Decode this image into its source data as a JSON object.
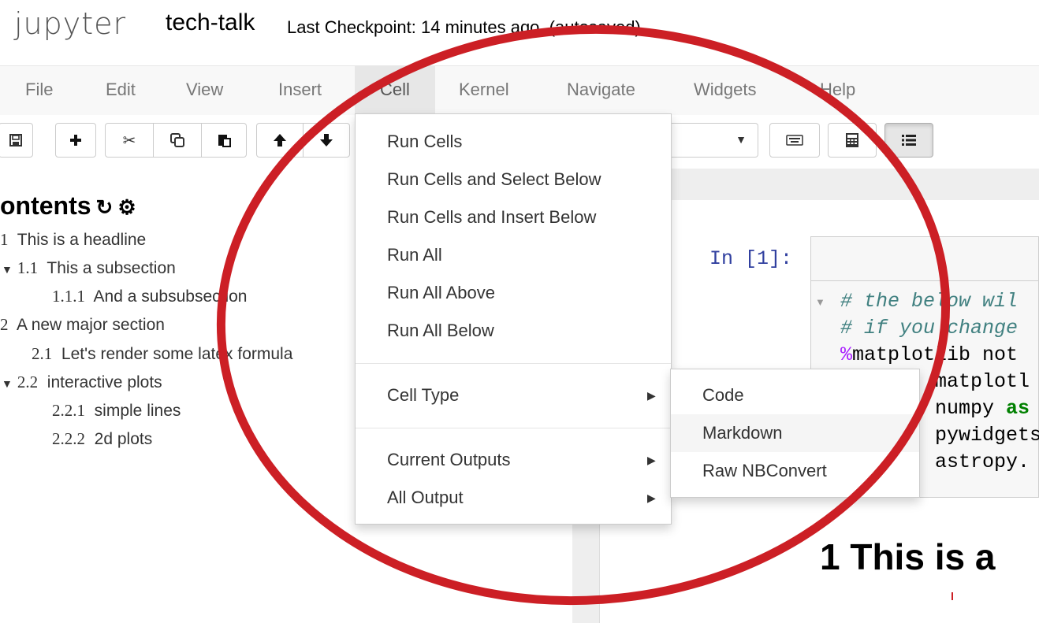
{
  "header": {
    "logo": "jupyter",
    "notebook_name": "tech-talk",
    "checkpoint": "Last Checkpoint: 14 minutes ago",
    "autosave": "(autosaved)"
  },
  "menubar": {
    "items": [
      {
        "label": "File"
      },
      {
        "label": "Edit"
      },
      {
        "label": "View"
      },
      {
        "label": "Insert"
      },
      {
        "label": "Cell"
      },
      {
        "label": "Kernel"
      },
      {
        "label": "Navigate"
      },
      {
        "label": "Widgets"
      },
      {
        "label": "Help"
      }
    ],
    "active": "Cell"
  },
  "toolbar": {
    "icons": [
      "save-icon",
      "plus-icon",
      "scissors-icon",
      "copy-icon",
      "paste-icon",
      "arrow-up-icon",
      "arrow-down-icon",
      "keyboard-icon",
      "calculator-icon",
      "list-icon"
    ],
    "celltype_arrow": "▼"
  },
  "toc": {
    "title": "ontents",
    "refresh_icon": "↻",
    "gear_icon": "⚙",
    "items": [
      {
        "num": "1",
        "label": "This is a headline"
      },
      {
        "num": "1.1",
        "label": "This a subsection"
      },
      {
        "num": "1.1.1",
        "label": "And a subsubsection"
      },
      {
        "num": "2",
        "label": "A new major section"
      },
      {
        "num": "2.1",
        "label": "Let's render some latex formula"
      },
      {
        "num": "2.2",
        "label": "interactive plots"
      },
      {
        "num": "2.2.1",
        "label": "simple lines"
      },
      {
        "num": "2.2.2",
        "label": "2d plots"
      }
    ]
  },
  "cell_menu": {
    "items": [
      {
        "label": "Run Cells"
      },
      {
        "label": "Run Cells and Select Below"
      },
      {
        "label": "Run Cells and Insert Below"
      },
      {
        "label": "Run All"
      },
      {
        "label": "Run All Above"
      },
      {
        "label": "Run All Below"
      },
      {
        "label": "Cell Type"
      },
      {
        "label": "Current Outputs"
      },
      {
        "label": "All Output"
      }
    ],
    "submenu_arrow": "▶"
  },
  "celltype_submenu": {
    "items": [
      {
        "label": "Code"
      },
      {
        "label": "Markdown"
      },
      {
        "label": "Raw NBConvert"
      }
    ],
    "highlighted": "Markdown"
  },
  "code_cell": {
    "prompt": "In [1]:",
    "lines": [
      {
        "text": "# the below wil"
      },
      {
        "text": "# if you change"
      },
      {
        "magic": "%",
        "text": "matplotlib not"
      },
      {
        "text": "matplotl"
      },
      {
        "text": "numpy ",
        "kw": "as"
      },
      {
        "text": "pywidgets"
      },
      {
        "text": "astropy."
      }
    ]
  },
  "markdown": {
    "heading": "1  This is a"
  },
  "colors": {
    "annotation_red": "#cc1f25",
    "prompt_blue": "#303f9f",
    "comment_green": "#408080"
  }
}
